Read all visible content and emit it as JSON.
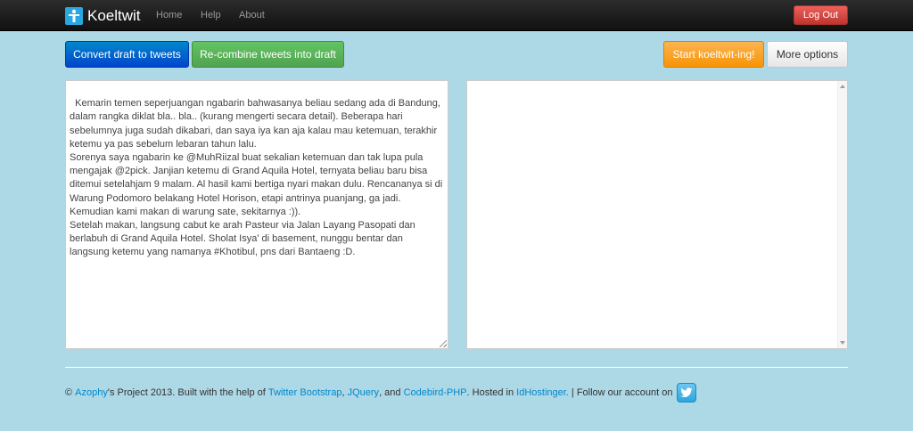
{
  "navbar": {
    "brand": "Koeltwit",
    "links": [
      "Home",
      "Help",
      "About"
    ],
    "logout_label": "Log Out"
  },
  "toolbar": {
    "convert_label": "Convert draft to tweets",
    "recombine_label": "Re-combine tweets into draft",
    "start_label": "Start koeltwit-ing!",
    "more_label": "More options"
  },
  "draft": {
    "text": "Kemarin temen seperjuangan ngabarin bahwasanya beliau sedang ada di Bandung, dalam rangka diklat bla.. bla.. (kurang mengerti secara detail). Beberapa hari sebelumnya juga sudah dikabari, dan saya iya kan aja kalau mau ketemuan, terakhir ketemu ya pas sebelum lebaran tahun lalu.\nSorenya saya ngabarin ke @MuhRiizal buat sekalian ketemuan dan tak lupa pula mengajak @2pick. Janjian ketemu di Grand Aquila Hotel, ternyata beliau baru bisa ditemui setelahjam 9 malam. Al hasil kami bertiga nyari makan dulu. Rencananya si di Warung Podomoro belakang Hotel Horison, etapi antrinya puanjang, ga jadi. Kemudian kami makan di warung sate, sekitarnya :)).\nSetelah makan, langsung cabut ke arah Pasteur via Jalan Layang Pasopati dan berlabuh di Grand Aquila Hotel. Sholat Isya' di basement, nunggu bentar dan langsung ketemu yang namanya #Khotibul, pns dari Bantaeng :D."
  },
  "tweets": {
    "text": ""
  },
  "footer": {
    "copyright": "© ",
    "author_link": "Azophy",
    "project_text": "'s Project 2013. Built with the help of ",
    "bootstrap_link": "Twitter Bootstrap",
    "comma1": ", ",
    "jquery_link": "JQuery",
    "and_text": ", and ",
    "codebird_link": "Codebird-PHP",
    "hosted_text": ". Hosted in ",
    "host_link": "IdHostinger.",
    "follow_text": " | Follow our account on"
  },
  "colors": {
    "background": "#add8e6",
    "primary": "#0077cc",
    "success": "#5bb75b",
    "warning": "#faa732",
    "danger": "#da4f49",
    "link": "#0088cc"
  },
  "icons": {
    "brand": "koeltwit-logo-icon",
    "twitter": "twitter-bird-icon"
  }
}
